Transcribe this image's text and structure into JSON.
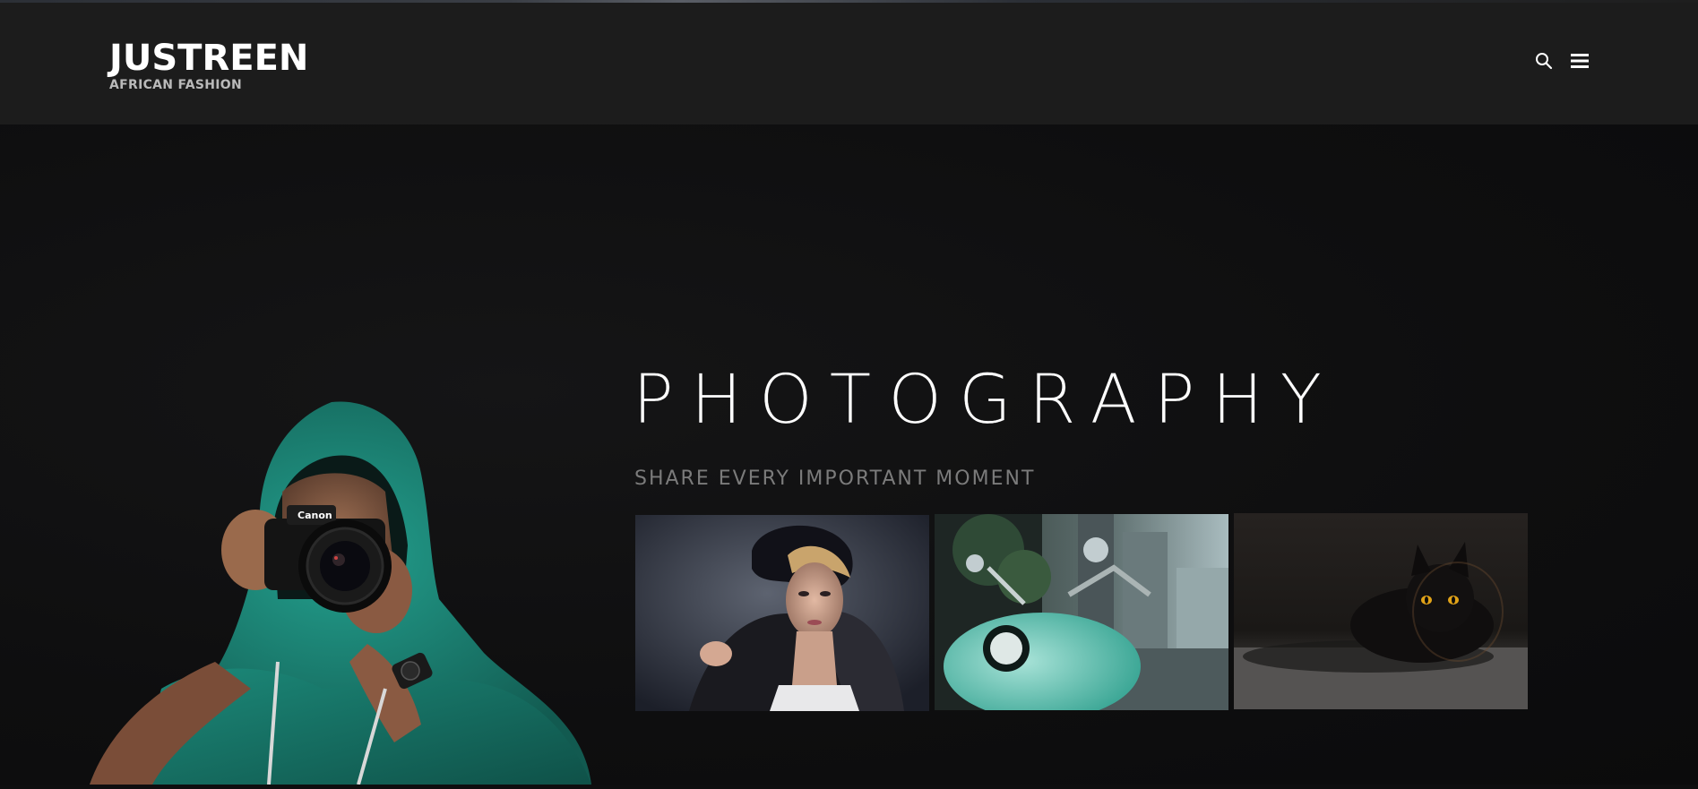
{
  "header": {
    "brand_title": "JUSTREEN",
    "brand_tagline": "AFRICAN FASHION",
    "icons": [
      "search-icon",
      "hamburger-menu-icon"
    ]
  },
  "hero": {
    "title": "PHOTOGRAPHY",
    "subtitle": "SHARE EVERY IMPORTANT MOMENT",
    "image": "photographer-with-camera-image"
  },
  "gallery": {
    "items": [
      "fashion-model-photo",
      "mint-scooter-photo",
      "black-cat-photo"
    ]
  },
  "colors": {
    "header_bg": "#1c1c1c",
    "page_bg": "#0e0e0f",
    "title": "#ffffff",
    "subtitle": "#7b7b7b",
    "tagline": "#b9b9b9",
    "hoodie": "#1f8a7a"
  }
}
